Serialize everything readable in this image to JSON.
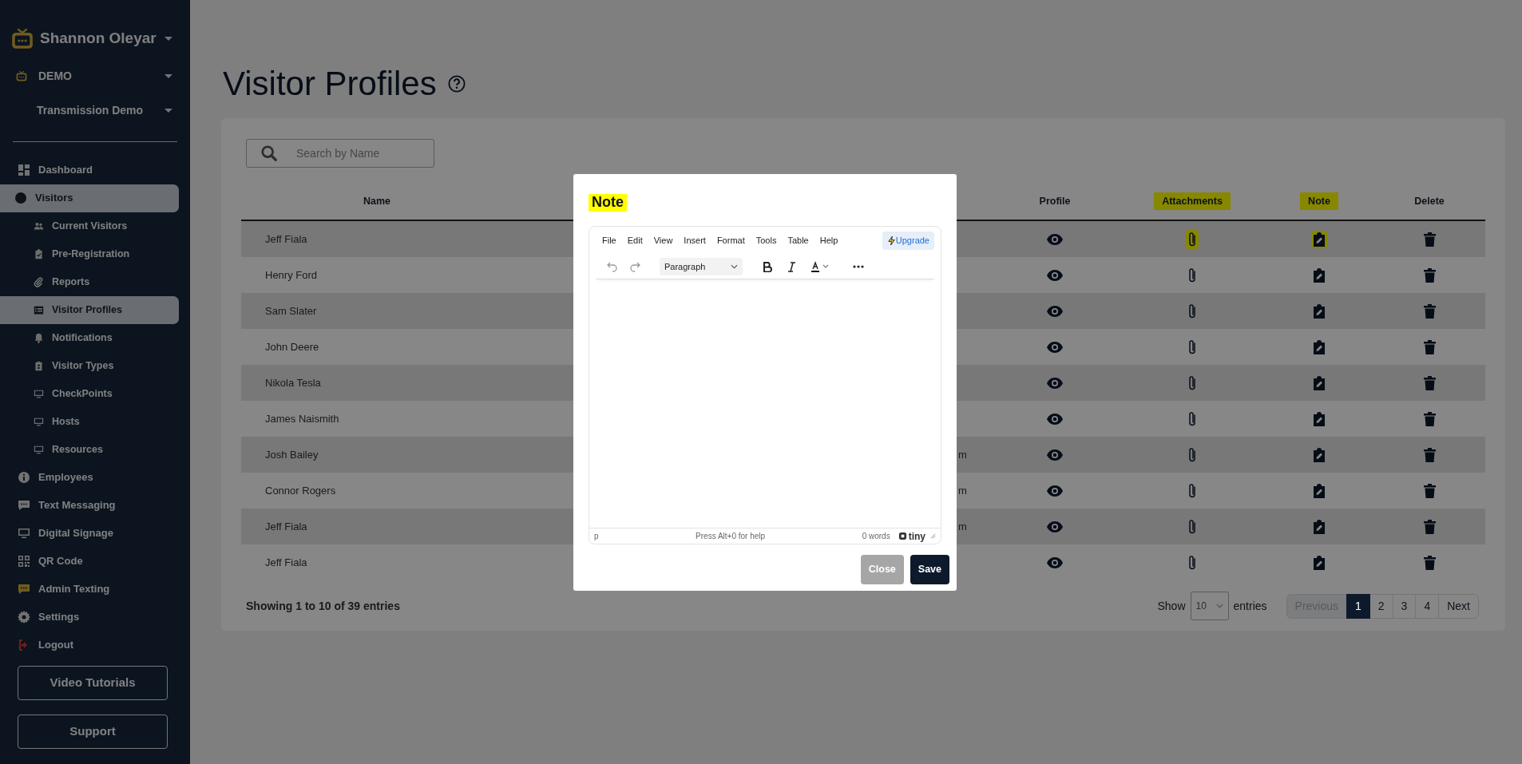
{
  "sidebar": {
    "user": {
      "name": "Shannon Oleyar"
    },
    "account": {
      "name": "DEMO"
    },
    "location": {
      "name": "Transmission Demo"
    },
    "items": [
      {
        "label": "Dashboard",
        "selected": false
      },
      {
        "label": "Visitors",
        "selected": true,
        "children": [
          {
            "label": "Current Visitors",
            "selected": false
          },
          {
            "label": "Pre-Registration",
            "selected": false
          },
          {
            "label": "Reports",
            "selected": false
          },
          {
            "label": "Visitor Profiles",
            "selected": true
          },
          {
            "label": "Notifications",
            "selected": false
          },
          {
            "label": "Visitor Types",
            "selected": false
          },
          {
            "label": "CheckPoints",
            "selected": false
          },
          {
            "label": "Hosts",
            "selected": false
          },
          {
            "label": "Resources",
            "selected": false
          }
        ]
      },
      {
        "label": "Employees",
        "selected": false
      },
      {
        "label": "Text Messaging",
        "selected": false
      },
      {
        "label": "Digital Signage",
        "selected": false
      },
      {
        "label": "QR Code",
        "selected": false
      },
      {
        "label": "Admin Texting",
        "selected": false
      },
      {
        "label": "Settings",
        "selected": false
      },
      {
        "label": "Logout",
        "selected": false
      }
    ],
    "buttons": [
      "Video Tutorials",
      "Support"
    ]
  },
  "page": {
    "title": "Visitor Profiles"
  },
  "search": {
    "placeholder": "Search by Name"
  },
  "table": {
    "columns": [
      {
        "label": "Name",
        "kind": "text",
        "highlighted": false
      },
      {
        "label": "Profile",
        "kind": "view",
        "highlighted": false
      },
      {
        "label": "Attachments",
        "kind": "attach",
        "highlighted": true
      },
      {
        "label": "Note",
        "kind": "note",
        "highlighted": true
      },
      {
        "label": "Delete",
        "kind": "delete",
        "highlighted": false
      }
    ],
    "rows": [
      {
        "name": "Jeff Fiala",
        "attachment_highlighted": true,
        "note_highlighted": true
      },
      {
        "name": "Henry Ford",
        "attachment_highlighted": false,
        "note_highlighted": false
      },
      {
        "name": "Sam Slater",
        "attachment_highlighted": false,
        "note_highlighted": false
      },
      {
        "name": "John Deere",
        "attachment_highlighted": false,
        "note_highlighted": false
      },
      {
        "name": "Nikola Tesla",
        "attachment_highlighted": false,
        "note_highlighted": false
      },
      {
        "name": "James Naismith",
        "attachment_highlighted": false,
        "note_highlighted": false
      },
      {
        "name": "Josh Bailey",
        "column_2": "m",
        "attachment_highlighted": false,
        "note_highlighted": false
      },
      {
        "name": "Connor Rogers",
        "column_2": "m",
        "attachment_highlighted": false,
        "note_highlighted": false
      },
      {
        "name": "Jeff Fiala",
        "column_2": "m",
        "attachment_highlighted": false,
        "note_highlighted": false
      },
      {
        "name": "Jeff Fiala",
        "attachment_highlighted": false,
        "note_highlighted": false
      }
    ]
  },
  "footer": {
    "info": "Showing 1 to 10 of 39 entries",
    "show_label": "Show",
    "page_size": "10",
    "entries_label": "entries",
    "pagination": [
      {
        "label": "Previous",
        "kind": "step",
        "disabled": true
      },
      {
        "label": "1",
        "kind": "page",
        "selected": true
      },
      {
        "label": "2",
        "kind": "page",
        "selected": false
      },
      {
        "label": "3",
        "kind": "page",
        "selected": false
      },
      {
        "label": "4",
        "kind": "page",
        "selected": false
      },
      {
        "label": "Next",
        "kind": "step",
        "disabled": false
      }
    ]
  },
  "modal": {
    "title": "Note",
    "title_highlighted": true,
    "editor": {
      "menu": [
        "File",
        "Edit",
        "View",
        "Insert",
        "Format",
        "Tools",
        "Table",
        "Help"
      ],
      "upgrade": "Upgrade",
      "undo_disabled": true,
      "redo_disabled": true,
      "block_format": "Paragraph",
      "status_path": "p",
      "help": "Press Alt+0 for help",
      "word_count": "0 words",
      "brand": "tiny"
    },
    "buttons": [
      {
        "label": "Close",
        "kind": "secondary"
      },
      {
        "label": "Save",
        "kind": "primary"
      }
    ]
  }
}
